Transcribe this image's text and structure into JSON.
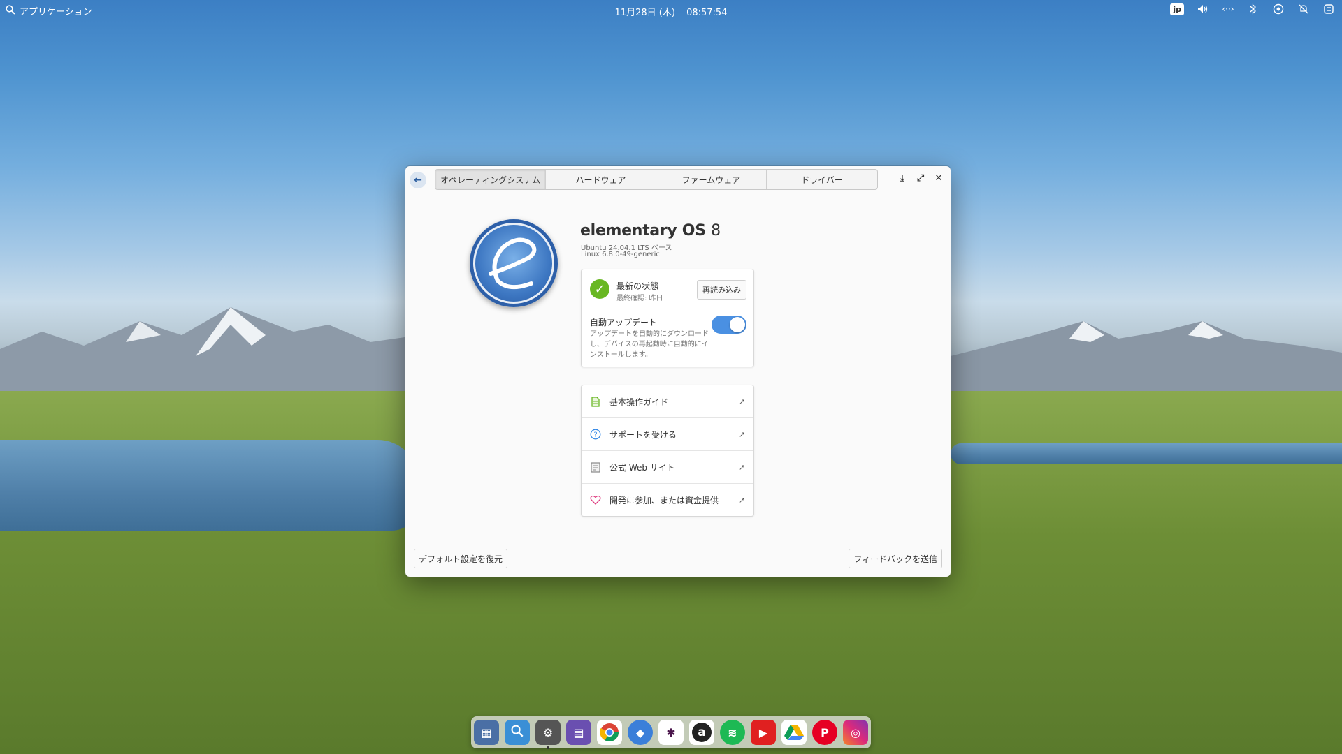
{
  "panel": {
    "apps_label": "アプリケーション",
    "date": "11月28日 (木)",
    "time": "08:57:54",
    "keyboard_layout": "jp",
    "tray_icons": [
      "volume-icon",
      "network-wired-icon",
      "bluetooth-icon",
      "night-light-icon",
      "notifications-off-icon",
      "session-icon"
    ]
  },
  "window": {
    "tabs": [
      {
        "label": "オペレーティングシステム",
        "active": true
      },
      {
        "label": "ハードウェア",
        "active": false
      },
      {
        "label": "ファームウェア",
        "active": false
      },
      {
        "label": "ドライバー",
        "active": false
      }
    ],
    "os": {
      "name": "elementary OS",
      "version": "8",
      "base": "Ubuntu 24.04.1 LTS ベース",
      "kernel": "Linux 6.8.0-49-generic"
    },
    "updates": {
      "status_title": "最新の状態",
      "status_sub": "最終確認: 昨日",
      "reload_label": "再読み込み",
      "auto_title": "自動アップデート",
      "auto_desc": "アップデートを自動的にダウンロードし、デバイスの再起動時に自動的にインストールします。",
      "auto_enabled": true
    },
    "links": [
      {
        "label": "基本操作ガイド",
        "icon": "document-icon",
        "color": "#68b723"
      },
      {
        "label": "サポートを受ける",
        "icon": "help-icon",
        "color": "#3689e6"
      },
      {
        "label": "公式 Web サイト",
        "icon": "website-icon",
        "color": "#888888"
      },
      {
        "label": "開発に参加、または資金提供",
        "icon": "heart-icon",
        "color": "#de3e80"
      }
    ],
    "restore_label": "デフォルト設定を復元",
    "feedback_label": "フィードバックを送信"
  },
  "dock": {
    "apps": [
      {
        "name": "multitasking-view",
        "color": "#4a6fa5",
        "glyph": "▦"
      },
      {
        "name": "files",
        "color": "#3a8fd6",
        "glyph": "🔍"
      },
      {
        "name": "system-settings",
        "color": "#555555",
        "glyph": "⚙"
      },
      {
        "name": "appcenter",
        "color": "#6a4fb0",
        "glyph": "▤"
      },
      {
        "name": "chrome",
        "color": "#ffffff",
        "glyph": "◉"
      },
      {
        "name": "web-browser",
        "color": "#3b7fd9",
        "glyph": "◆"
      },
      {
        "name": "slack",
        "color": "#ffffff",
        "glyph": "✱"
      },
      {
        "name": "amazon",
        "color": "#222222",
        "glyph": "a"
      },
      {
        "name": "spotify",
        "color": "#1db954",
        "glyph": "≋"
      },
      {
        "name": "youtube",
        "color": "#e02020",
        "glyph": "▶"
      },
      {
        "name": "google-drive",
        "color": "#ffffff",
        "glyph": "△"
      },
      {
        "name": "pinterest",
        "color": "#e60023",
        "glyph": "P"
      },
      {
        "name": "instagram",
        "color": "#d6306d",
        "glyph": "◎"
      }
    ]
  }
}
